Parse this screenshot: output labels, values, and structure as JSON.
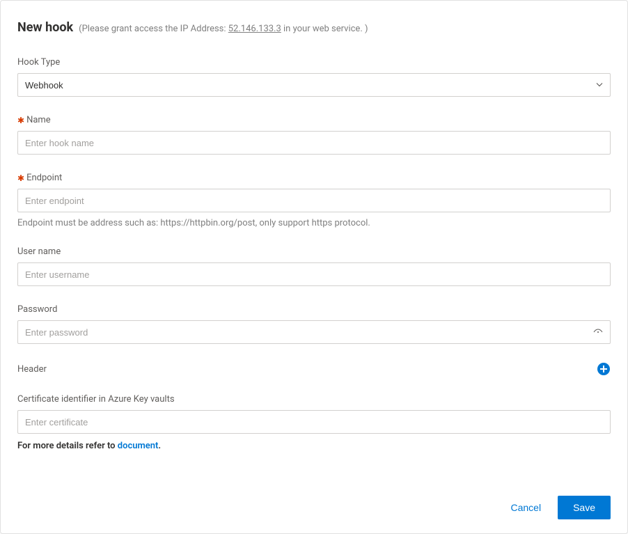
{
  "header": {
    "title": "New hook",
    "subtitle_prefix": "(Please grant access the IP Address: ",
    "ip": "52.146.133.3",
    "subtitle_suffix": " in your web service. )"
  },
  "fields": {
    "hook_type": {
      "label": "Hook Type",
      "value": "Webhook"
    },
    "name": {
      "label": "Name",
      "placeholder": "Enter hook name"
    },
    "endpoint": {
      "label": "Endpoint",
      "placeholder": "Enter endpoint",
      "help": "Endpoint must be address such as: https://httpbin.org/post, only support https protocol."
    },
    "username": {
      "label": "User name",
      "placeholder": "Enter username"
    },
    "password": {
      "label": "Password",
      "placeholder": "Enter password"
    },
    "header_section": {
      "label": "Header"
    },
    "certificate": {
      "label": "Certificate identifier in Azure Key vaults",
      "placeholder": "Enter certificate"
    },
    "docs": {
      "prefix": "For more details refer to ",
      "link": "document",
      "suffix": "."
    }
  },
  "footer": {
    "cancel": "Cancel",
    "save": "Save"
  }
}
